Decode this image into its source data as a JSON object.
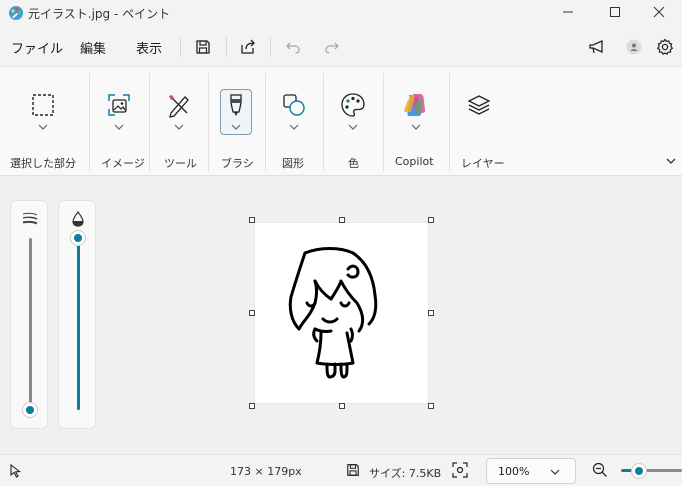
{
  "window": {
    "title": "元イラスト.jpg - ペイント"
  },
  "menu": {
    "file": "ファイル",
    "edit": "編集",
    "view": "表示"
  },
  "ribbon": {
    "groups": [
      {
        "label": "選択した部分",
        "icon": "selection-icon"
      },
      {
        "label": "イメージ",
        "icon": "image-icon"
      },
      {
        "label": "ツール",
        "icon": "tools-icon"
      },
      {
        "label": "ブラシ",
        "icon": "brush-icon"
      },
      {
        "label": "図形",
        "icon": "shapes-icon"
      },
      {
        "label": "色",
        "icon": "palette-icon"
      },
      {
        "label": "Copilot",
        "icon": "copilot-icon"
      },
      {
        "label": "レイヤー",
        "icon": "layers-icon"
      }
    ]
  },
  "sliders": {
    "size_level": 0.0,
    "opacity_level": 1.0
  },
  "status": {
    "dimensions": "173 × 179px",
    "size": "サイズ: 7.5KB",
    "zoom": "100%"
  },
  "colors": {
    "accent": "#0b7e9c",
    "background": "#f3f3f3"
  }
}
